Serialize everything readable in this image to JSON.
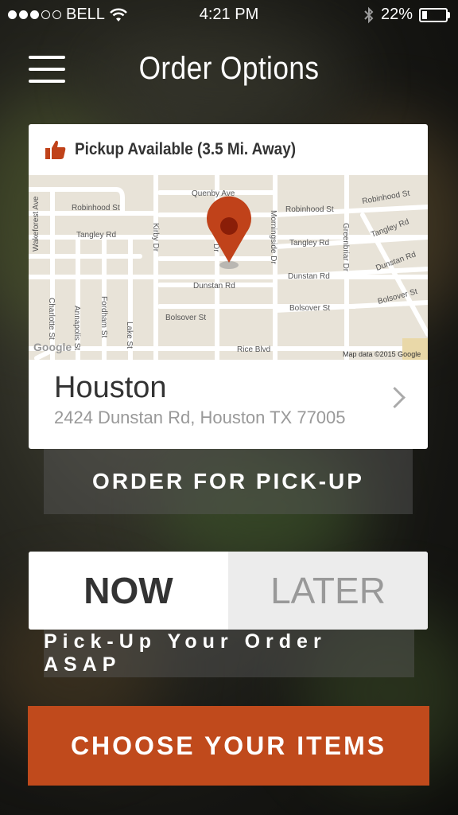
{
  "status_bar": {
    "carrier": "BELL",
    "time": "4:21 PM",
    "battery": "22%",
    "battery_level": 0.22,
    "signal_dots_filled": 3,
    "signal_dots_total": 5,
    "icons": [
      "wifi-icon",
      "bluetooth-icon",
      "battery-icon"
    ]
  },
  "nav": {
    "title": "Order Options",
    "menu_icon": "hamburger-menu-icon"
  },
  "location_card": {
    "pickup_label": "Pickup Available (3.5 Mi. Away)",
    "pickup_icon": "thumbs-up-icon",
    "name": "Houston",
    "address": "2424 Dunstan Rd, Houston TX 77005",
    "map": {
      "attribution": "Map data ©2015 Google",
      "logo": "Google",
      "pin_icon": "map-pin-icon",
      "streets": {
        "quenby": "Quenby Ave",
        "robinhood1": "Robinhood St",
        "robinhood2": "Robinhood St",
        "robinhood3": "Robinhood St",
        "tangley1": "Tangley Rd",
        "tangley2": "Tangley Rd",
        "tangley3": "Tangley Rd",
        "dunstan1": "Dunstan Rd",
        "dunstan2": "Dunstan Rd",
        "dunstan3": "Dunstan Rd",
        "bolsover1": "Bolsover St",
        "bolsover2": "Bolsover St",
        "bolsover3": "Bolsover St",
        "rice": "Rice Blvd",
        "wakeforest": "Wakeforest Ave",
        "kirby": "Kirby Dr",
        "morningside": "Morningside Dr",
        "greenbriar": "Greenbriar Dr",
        "charlotte": "Charlotte St",
        "annapolis": "Annapolis St",
        "fordham": "Fordham St",
        "lake": "Lake St",
        "dr_short": "Dr"
      }
    }
  },
  "actions": {
    "order_pickup": "ORDER FOR PICK-UP",
    "toggle_now": "NOW",
    "toggle_later": "LATER",
    "toggle_selected": "NOW",
    "asap_text": "Pick-Up Your Order ASAP",
    "choose_items": "CHOOSE YOUR ITEMS"
  },
  "colors": {
    "accent": "#c04a1c",
    "pin": "#c0421a",
    "pin_center": "#8a1e08"
  }
}
